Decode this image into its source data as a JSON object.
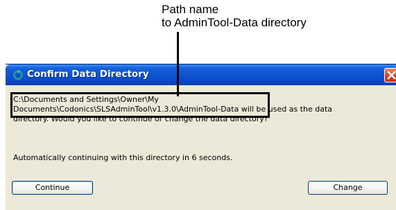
{
  "callout": {
    "line1": "Path name",
    "line2": "to AdminTool-Data directory"
  },
  "dialog": {
    "title": "Confirm Data Directory",
    "title_icon": "app-refresh-icon",
    "close_icon": "close-icon",
    "message": {
      "line1": "C:\\Documents and Settings\\Owner\\My",
      "line2_path": "Documents\\Codonics\\SLSAdminTool\\v1.3.0\\AdminTool-Data",
      "line2_rest": " will be used as the data",
      "line3": "directory. Would you like to continue or change the data directory?"
    },
    "countdown": "Automatically continuing with this directory in 6 seconds.",
    "buttons": {
      "continue": "Continue",
      "change": "Change"
    }
  },
  "colors": {
    "titlebar": "#0b52d0",
    "dialog_bg": "#ece9d8",
    "close": "#d3431b"
  }
}
